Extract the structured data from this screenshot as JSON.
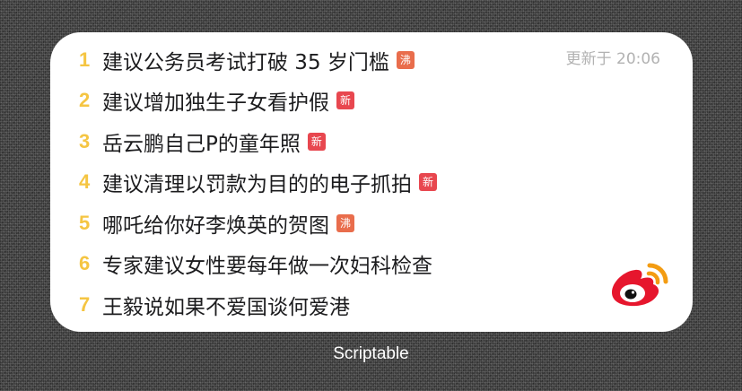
{
  "widget": {
    "updated_text": "更新于 20:06",
    "colors": {
      "rank": "#f5c542",
      "badge_hot": "#e96d4c",
      "badge_new": "#e8474f",
      "title": "#1c1c1e",
      "updated": "#b2b2b2"
    },
    "items": [
      {
        "rank": "1",
        "title": "建议公务员考试打破 35 岁门槛",
        "badge": "沸",
        "badge_type": "hot"
      },
      {
        "rank": "2",
        "title": "建议增加独生子女看护假",
        "badge": "新",
        "badge_type": "new"
      },
      {
        "rank": "3",
        "title": "岳云鹏自己P的童年照",
        "badge": "新",
        "badge_type": "new"
      },
      {
        "rank": "4",
        "title": "建议清理以罚款为目的的电子抓拍",
        "badge": "新",
        "badge_type": "new"
      },
      {
        "rank": "5",
        "title": "哪吒给你好李焕英的贺图",
        "badge": "沸",
        "badge_type": "hot"
      },
      {
        "rank": "6",
        "title": "专家建议女性要每年做一次妇科检查",
        "badge": "",
        "badge_type": ""
      },
      {
        "rank": "7",
        "title": "王毅说如果不爱国谈何爱港",
        "badge": "",
        "badge_type": ""
      }
    ],
    "logo_icon": "weibo-logo-icon"
  },
  "app_label": "Scriptable"
}
